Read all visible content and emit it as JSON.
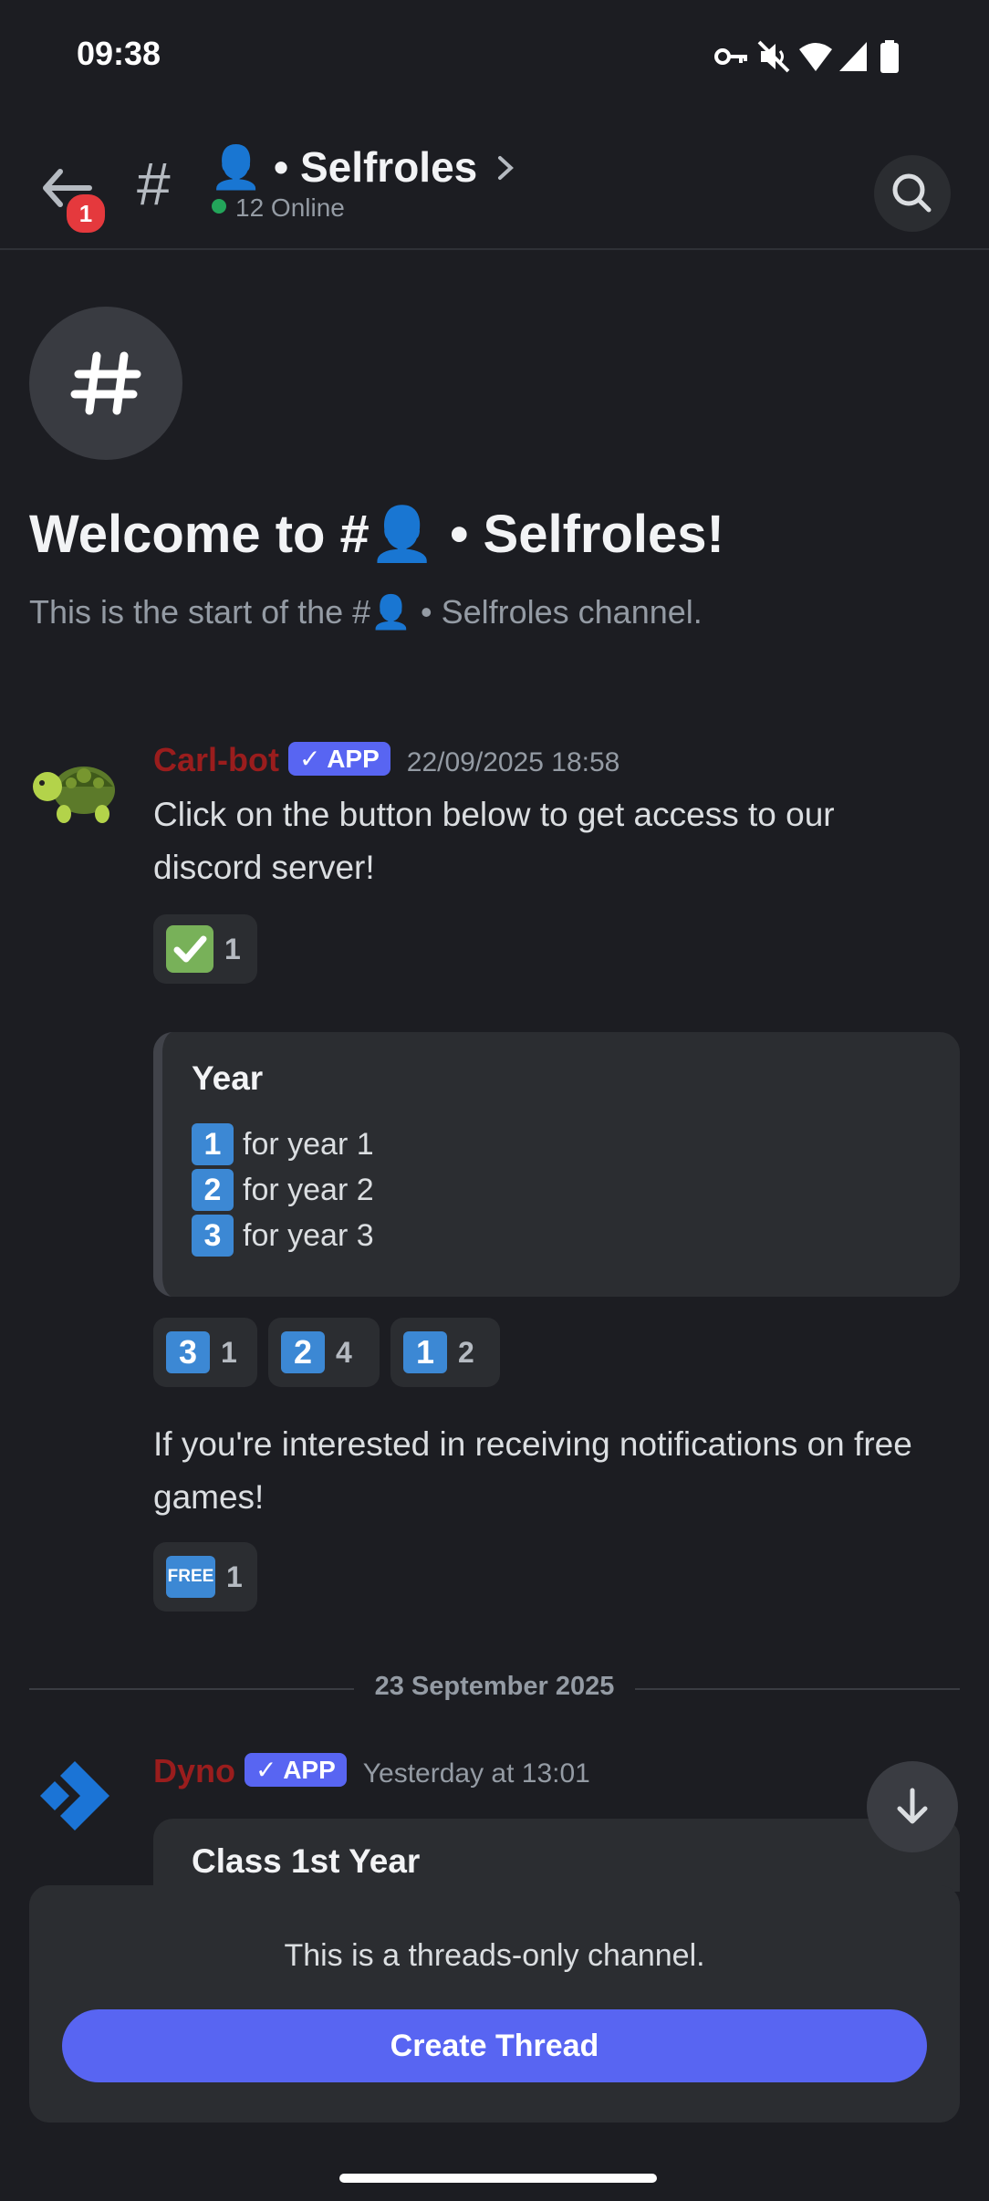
{
  "status_bar": {
    "time": "09:38"
  },
  "header": {
    "notification_count": "1",
    "channel_name": "👤 • Selfroles",
    "online_text": "12 Online"
  },
  "welcome": {
    "title": "Welcome to #👤 • Selfroles!",
    "subtitle": "This is the start of the #👤 • Selfroles channel."
  },
  "messages": [
    {
      "author": "Carl-bot",
      "badge": "✓ APP",
      "timestamp": "22/09/2025 18:58",
      "text": "Click on the button below to get access to our discord server!",
      "reactions": [
        {
          "emoji": "white-check-mark",
          "count": "1"
        }
      ],
      "embed": {
        "title": "Year",
        "lines": [
          {
            "key": "1",
            "text": "for year 1"
          },
          {
            "key": "2",
            "text": "for year 2"
          },
          {
            "key": "3",
            "text": "for year 3"
          }
        ]
      },
      "embed_reactions": [
        {
          "key": "3",
          "count": "1"
        },
        {
          "key": "2",
          "count": "4"
        },
        {
          "key": "1",
          "count": "2"
        }
      ],
      "text2": "If you're interested in receiving notifications on free games!",
      "reactions2": [
        {
          "emoji": "FREE",
          "count": "1"
        }
      ]
    },
    {
      "author": "Dyno",
      "badge": "✓ APP",
      "timestamp": "Yesterday at 13:01",
      "embed": {
        "title": "Class 1st Year"
      }
    }
  ],
  "date_divider": "23 September 2025",
  "composer": {
    "notice": "This is a threads-only channel.",
    "button_label": "Create Thread"
  },
  "colors": {
    "background": "#1c1d22",
    "accent": "#5865f2",
    "author_red": "#9a1d1d",
    "keycap_blue": "#3c88d4"
  }
}
